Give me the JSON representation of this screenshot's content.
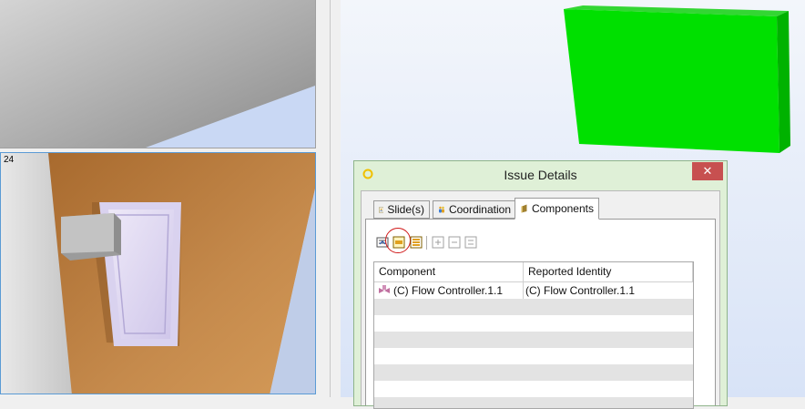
{
  "thumbnails": [
    {
      "number": ""
    },
    {
      "number": "24"
    }
  ],
  "dialog": {
    "title": "Issue Details",
    "close_label": "✕",
    "tabs": [
      {
        "label": "Slide(s)",
        "icon": "slide-icon",
        "active": false
      },
      {
        "label": "Coordination",
        "icon": "people-icon",
        "active": false
      },
      {
        "label": "Components",
        "icon": "component-icon",
        "active": true
      }
    ],
    "toolbar": [
      "view-icon",
      "select-highlighted-icon",
      "select-all-icon",
      "add-icon",
      "remove-icon",
      "clear-icon"
    ],
    "grid": {
      "columns": [
        "Component",
        "Reported Identity"
      ],
      "rows": [
        {
          "component": "(C) Flow Controller.1.1",
          "reported_identity": "(C) Flow Controller.1.1"
        }
      ]
    }
  },
  "colors": {
    "viewport_top": "#f3f6fb",
    "viewport_bottom": "#d8e3f7",
    "green_box": "#00e000",
    "dialog_frame": "#dff0d7",
    "close_button": "#c75050",
    "highlight_ring": "#d01818",
    "wall_orange": "#c08038"
  }
}
